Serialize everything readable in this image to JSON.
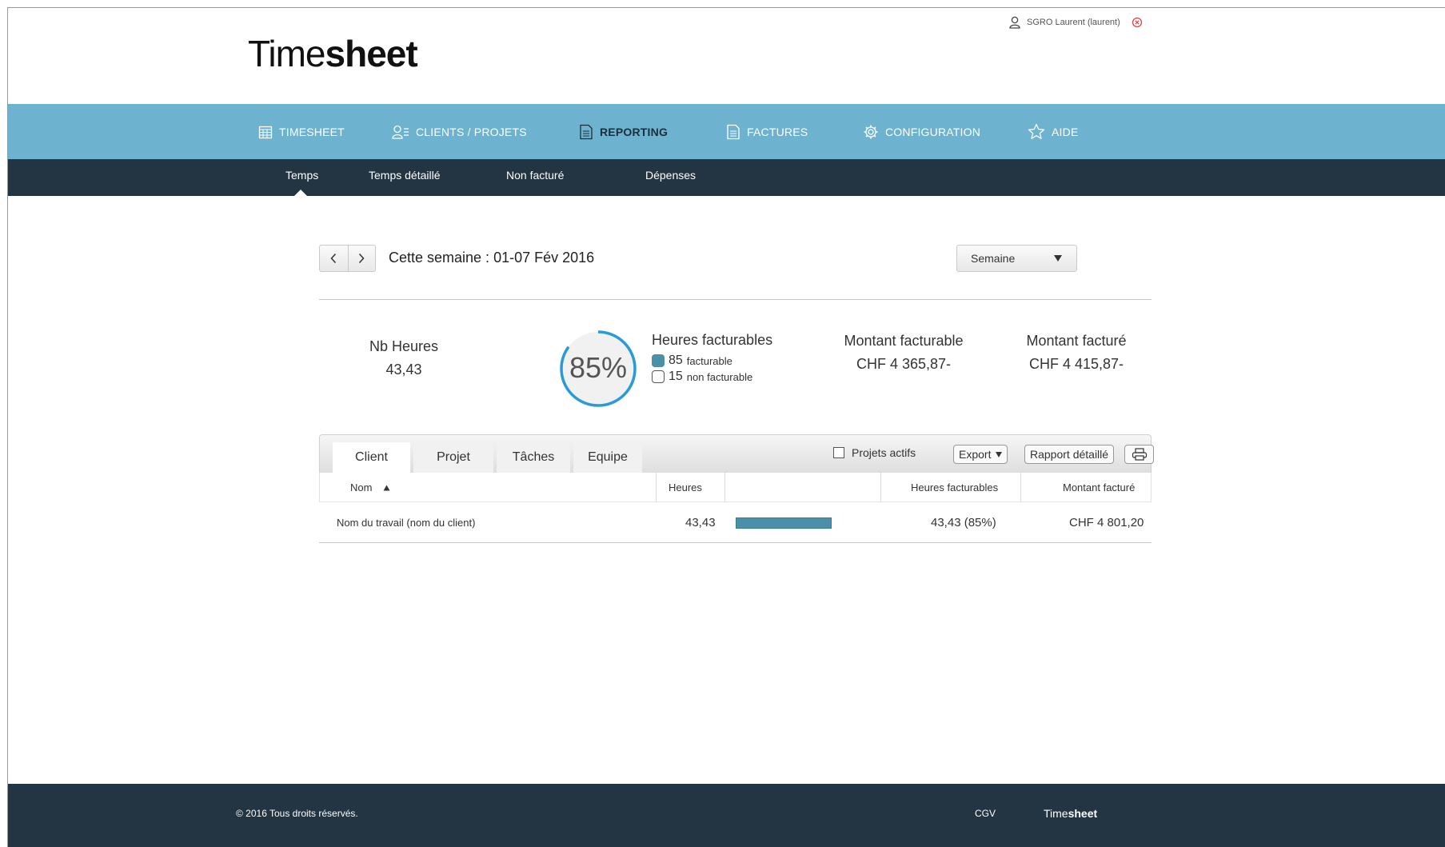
{
  "header": {
    "logo_light": "Time",
    "logo_bold": "sheet",
    "user_name": "SGRO Laurent (laurent)"
  },
  "main_nav": [
    {
      "label": "TIMESHEET",
      "icon": "calendar-icon"
    },
    {
      "label": "CLIENTS / PROJETS",
      "icon": "contacts-icon"
    },
    {
      "label": "REPORTING",
      "icon": "document-icon",
      "active": true
    },
    {
      "label": "FACTURES",
      "icon": "document-icon"
    },
    {
      "label": "CONFIGURATION",
      "icon": "gear-icon"
    },
    {
      "label": "AIDE",
      "icon": "star-icon"
    }
  ],
  "sub_nav": [
    {
      "label": "Temps",
      "active": true
    },
    {
      "label": "Temps détaillé"
    },
    {
      "label": "Non facturé"
    },
    {
      "label": "Dépenses"
    }
  ],
  "week": {
    "title": "Cette semaine : 01-07 Fév 2016",
    "period": "Semaine"
  },
  "summary": {
    "nb_heures_label": "Nb Heures",
    "nb_heures_value": "43,43",
    "percent": "85%",
    "percent_value": 85,
    "heures_facturables_label": "Heures facturables",
    "facturable_num": "85",
    "facturable_label": "facturable",
    "non_facturable_num": "15",
    "non_facturable_label": "non facturable",
    "montant_facturable_label": "Montant facturable",
    "montant_facturable_value": "CHF 4 365,87-",
    "montant_facture_label": "Montant facturé",
    "montant_facture_value": "CHF 4 415,87-"
  },
  "table": {
    "tabs": [
      "Client",
      "Projet",
      "Tâches",
      "Equipe"
    ],
    "projets_actifs": "Projets actifs",
    "export": "Export",
    "rapport": "Rapport détaillé",
    "columns": {
      "nom": "Nom",
      "heures": "Heures",
      "heures_facturables": "Heures facturables",
      "montant_facture": "Montant facturé"
    },
    "rows": [
      {
        "nom": "Nom du travail (nom du client)",
        "heures": "43,43",
        "bar_fraction": 1.0,
        "heures_facturables": "43,43 (85%)",
        "montant_facture": "CHF 4 801,20"
      }
    ]
  },
  "footer": {
    "copyright": "© 2016 Tous droits réservés.",
    "cgv": "CGV",
    "logo_light": "Time",
    "logo_bold": "sheet"
  },
  "colors": {
    "nav": "#6db3d0",
    "subnav": "#233442",
    "accent": "#4b8fa8",
    "ring": "#2a9bd8",
    "logout": "#e0454a"
  }
}
